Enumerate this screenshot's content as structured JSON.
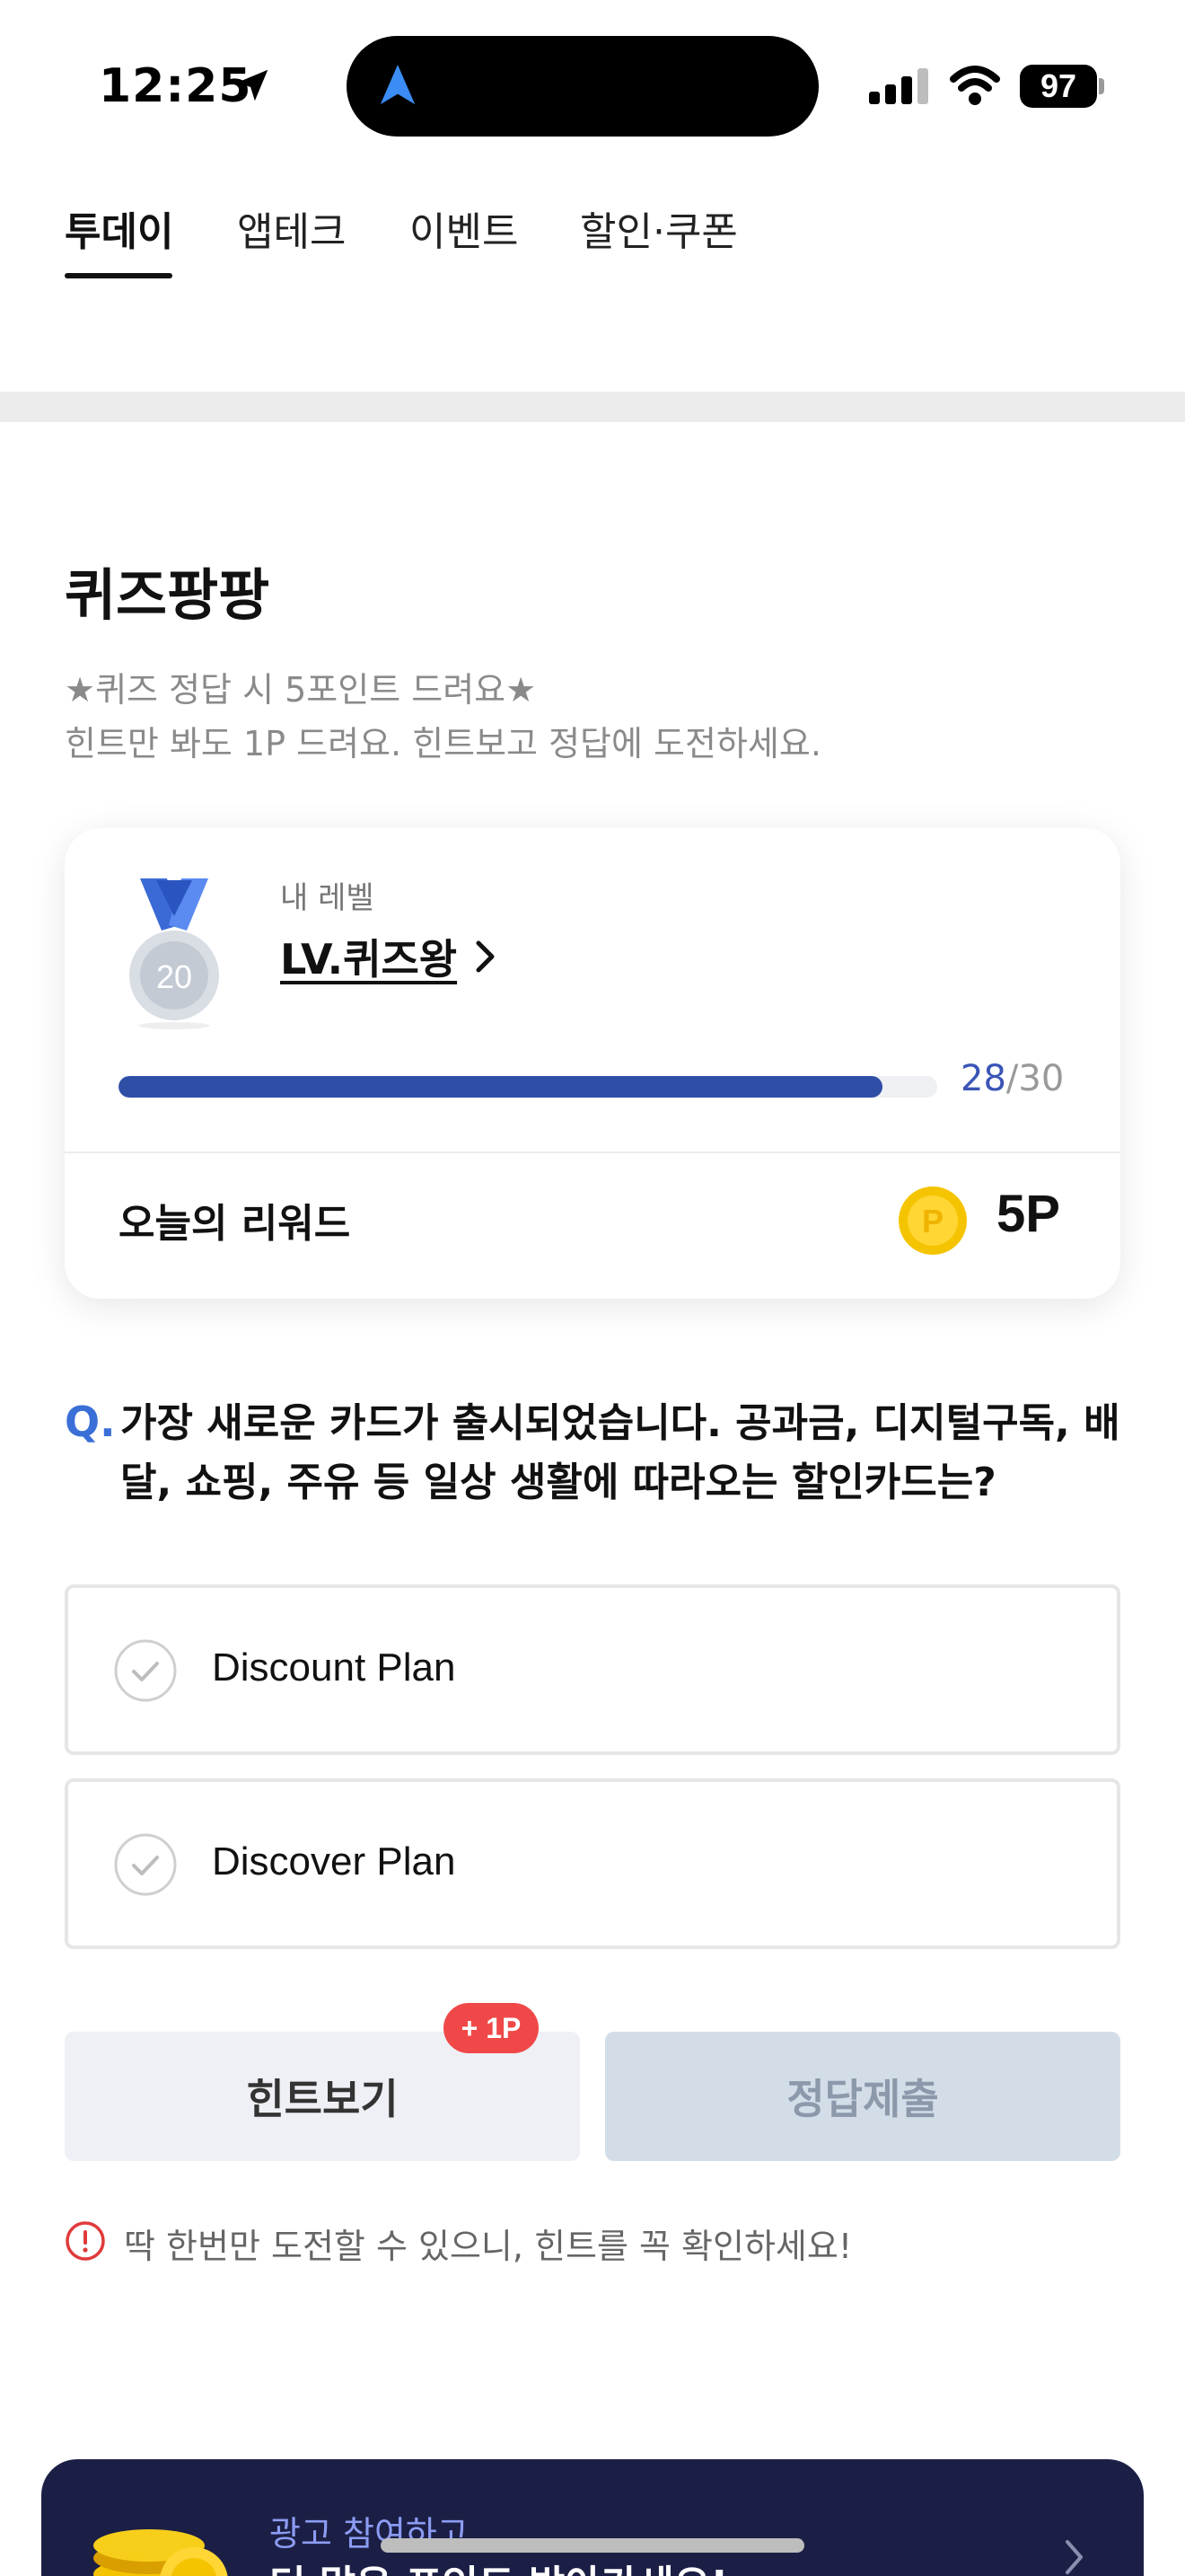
{
  "status_bar": {
    "time": "12:25",
    "battery": "97"
  },
  "tabs": [
    {
      "label": "투데이",
      "active": true
    },
    {
      "label": "앱테크",
      "active": false
    },
    {
      "label": "이벤트",
      "active": false
    },
    {
      "label": "할인·쿠폰",
      "active": false
    }
  ],
  "quiz": {
    "title": "퀴즈팡팡",
    "desc_line1": "★퀴즈 정답 시 5포인트 드려요★",
    "desc_line2": "힌트만 봐도 1P 드려요. 힌트보고 정답에 도전하세요."
  },
  "level_card": {
    "medal_number": "20",
    "label": "내 레벨",
    "level_name": "LV.퀴즈왕",
    "progress_current": "28",
    "progress_separator": "/",
    "progress_total": "30",
    "progress_fraction": 0.933,
    "reward_label": "오늘의 리워드",
    "coin_letter": "P",
    "reward_value": "5P"
  },
  "question": {
    "marker": "Q.",
    "text": "가장 새로운 카드가 출시되었습니다. 공과금, 디지털구독, 배달, 쇼핑, 주유 등 일상 생활에 따라오는 할인카드는?"
  },
  "options": [
    {
      "label": "Discount Plan"
    },
    {
      "label": "Discover Plan"
    }
  ],
  "actions": {
    "hint_label": "힌트보기",
    "hint_badge": "+ 1P",
    "submit_label": "정답제출"
  },
  "warning": {
    "text": "딱 한번만 도전할 수 있으니, 힌트를 꼭 확인하세요!"
  },
  "ad": {
    "line1": "광고 참여하고",
    "line2": "더 많은 포인트 받아가세요!"
  },
  "colors": {
    "accent_blue": "#2f4ea6",
    "question_blue": "#3a6fd8",
    "badge_red": "#f04848",
    "coin_gold": "#f5c400",
    "ad_bg": "#1c1f45"
  },
  "icons": [
    "location-arrow-icon",
    "navigation-icon",
    "signal-icon",
    "wifi-icon",
    "battery-icon",
    "medal-icon",
    "chevron-right-icon",
    "coin-icon",
    "check-circle-icon",
    "warning-icon"
  ]
}
